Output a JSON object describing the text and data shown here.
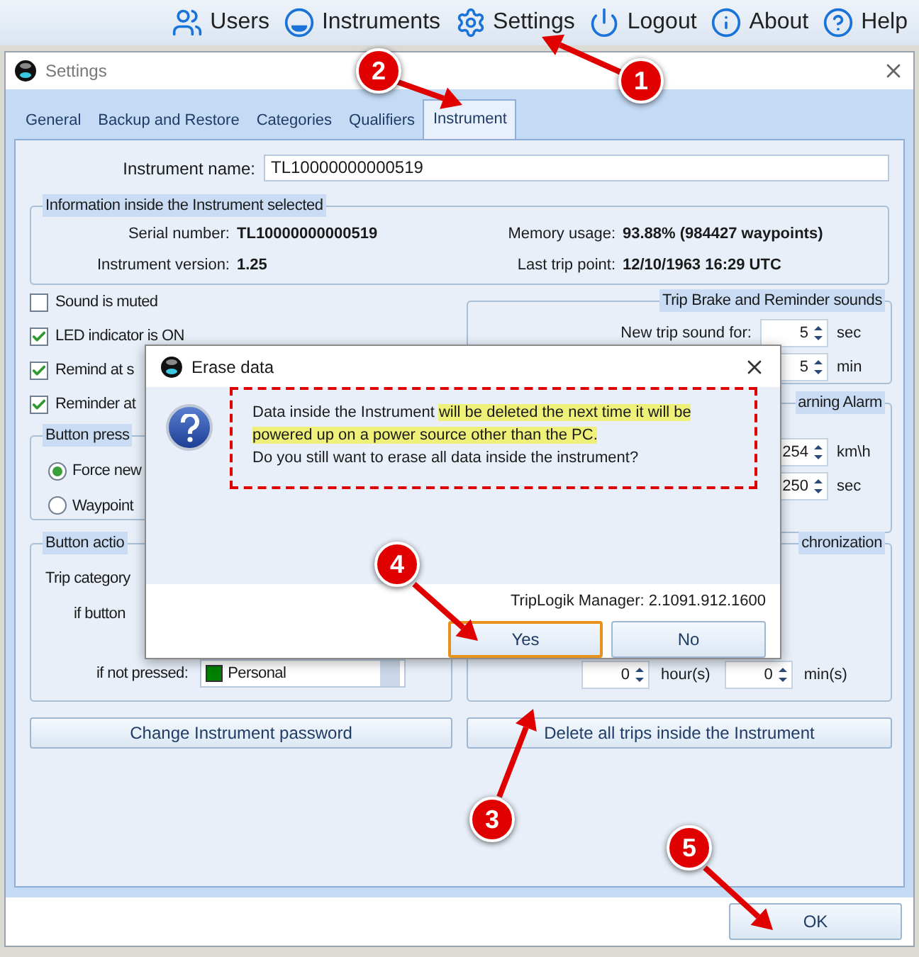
{
  "nav": [
    {
      "kind": "users",
      "label": "Users"
    },
    {
      "kind": "instruments",
      "label": "Instruments"
    },
    {
      "kind": "settings",
      "label": "Settings"
    },
    {
      "kind": "logout",
      "label": "Logout"
    },
    {
      "kind": "about",
      "label": "About"
    },
    {
      "kind": "help",
      "label": "Help"
    }
  ],
  "window": {
    "title": "Settings"
  },
  "tabs": [
    {
      "label": "General",
      "selected": false
    },
    {
      "label": "Backup and Restore",
      "selected": false
    },
    {
      "label": "Categories",
      "selected": false
    },
    {
      "label": "Qualifiers",
      "selected": false
    },
    {
      "label": "Instrument",
      "selected": true
    }
  ],
  "instrument_name": {
    "label": "Instrument name:",
    "value": "TL10000000000519"
  },
  "info": {
    "title": "Information inside the Instrument selected",
    "left": [
      {
        "label": "Serial number:",
        "value": "TL10000000000519"
      },
      {
        "label": "Instrument version:",
        "value": "1.25"
      }
    ],
    "right": [
      {
        "label": "Memory usage:",
        "value": "93.88% (984427 waypoints)"
      },
      {
        "label": "Last trip point:",
        "value": "12/10/1963 16:29 UTC"
      }
    ]
  },
  "checkboxes": [
    {
      "label": "Sound is muted",
      "checked": false
    },
    {
      "label": "LED indicator is ON",
      "checked": true
    },
    {
      "label": "Remind at s",
      "checked": true
    },
    {
      "label": "Reminder at",
      "checked": true
    }
  ],
  "button_press": {
    "title": "Button press",
    "options": [
      {
        "label": "Force new",
        "selected": true
      },
      {
        "label": "Waypoint",
        "selected": false
      }
    ]
  },
  "button_action": {
    "title": "Button actio",
    "trip_category": "Trip category",
    "if_button": "if button",
    "if_not_pressed": "if not pressed:",
    "category": {
      "value": "Personal",
      "color": "#008000"
    }
  },
  "sounds": {
    "title": "Trip Brake and Reminder sounds",
    "rows": [
      {
        "label": "New trip sound for:",
        "value": "5",
        "unit": "sec"
      },
      {
        "value": "5",
        "unit": "min"
      }
    ]
  },
  "alarm": {
    "title": "arning Alarm",
    "rows": [
      {
        "value": "254",
        "unit": "km\\h"
      },
      {
        "value": "250",
        "unit": "sec"
      }
    ]
  },
  "sync": {
    "title": "chronization",
    "rows": [
      {
        "value": "0",
        "unit": "hour(s)"
      },
      {
        "value": "0",
        "unit": "min(s)"
      }
    ]
  },
  "buttons": [
    "Change Instrument password",
    "Delete all trips inside the Instrument"
  ],
  "ok": "OK",
  "dialog": {
    "title": "Erase data",
    "message": [
      {
        "text": "Data inside the Instrument ",
        "highlighted": false
      },
      {
        "text": "will be deleted the next time it will be powered up on a power source other than the PC.",
        "highlighted": true
      }
    ],
    "question": "Do you still want to erase all data inside the instrument?",
    "version": "TripLogik Manager: 2.1091.912.1600",
    "buttons": [
      {
        "label": "Yes",
        "selected": true
      },
      {
        "label": "No",
        "selected": false
      }
    ]
  },
  "annotations": [
    {
      "label": "1"
    },
    {
      "label": "2"
    },
    {
      "label": "3"
    },
    {
      "label": "4"
    },
    {
      "label": "5"
    }
  ]
}
